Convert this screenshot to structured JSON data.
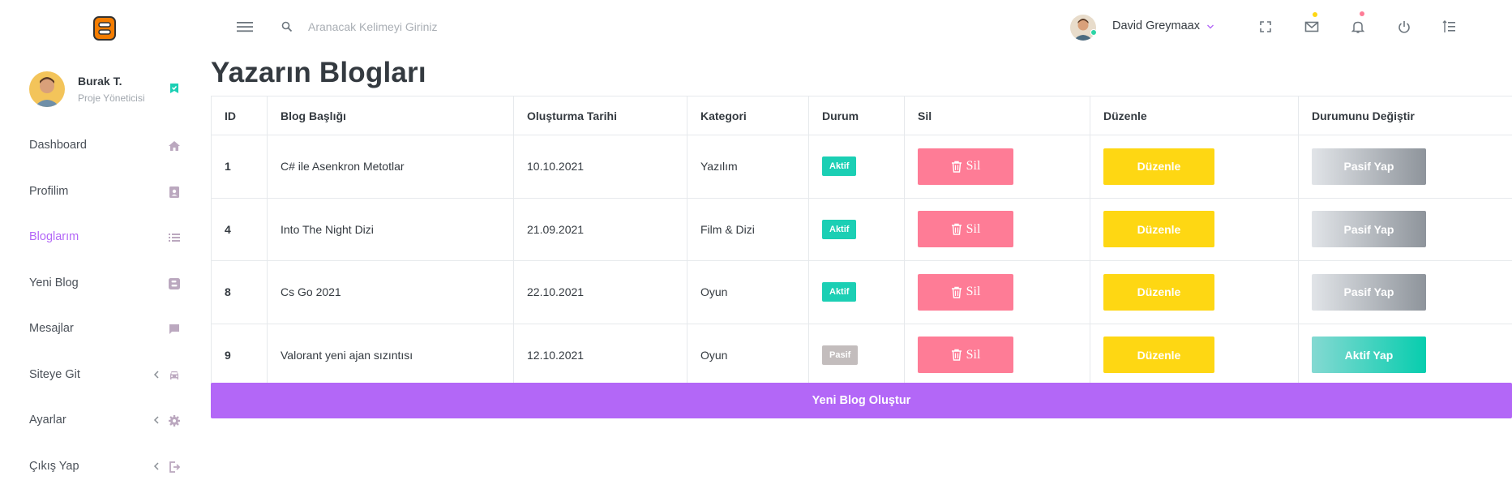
{
  "sidebar": {
    "logo_icon": "blogger-logo-icon",
    "profile": {
      "name": "Burak T.",
      "role": "Proje Yöneticisi"
    },
    "items": [
      {
        "label": "Dashboard",
        "icon": "home-icon"
      },
      {
        "label": "Profilim",
        "icon": "contact-card-icon"
      },
      {
        "label": "Bloglarım",
        "icon": "list-icon",
        "active": true
      },
      {
        "label": "Yeni Blog",
        "icon": "blogger-icon"
      },
      {
        "label": "Mesajlar",
        "icon": "message-icon"
      },
      {
        "label": "Siteye Git",
        "icon": "car-icon",
        "has_submenu": true
      },
      {
        "label": "Ayarlar",
        "icon": "gear-icon",
        "has_submenu": true
      },
      {
        "label": "Çıkış Yap",
        "icon": "logout-icon",
        "has_submenu": true
      }
    ]
  },
  "topbar": {
    "search_placeholder": "Aranacak Kelimeyi Giriniz",
    "user_name": "David Greymaax",
    "icons": [
      "fullscreen-icon",
      "mail-icon",
      "bell-icon",
      "power-icon",
      "format-list-icon"
    ]
  },
  "page": {
    "title": "Yazarın Blogları"
  },
  "table": {
    "headers": [
      "ID",
      "Blog Başlığı",
      "Oluşturma Tarihi",
      "Kategori",
      "Durum",
      "Sil",
      "Düzenle",
      "Durumunu Değiştir"
    ],
    "rows": [
      {
        "id": "1",
        "title": "C# ile Asenkron Metotlar",
        "date": "10.10.2021",
        "category": "Yazılım",
        "status": "Aktif",
        "delete": "Sil",
        "edit": "Düzenle",
        "toggle": "Pasif Yap"
      },
      {
        "id": "4",
        "title": "Into The Night Dizi",
        "date": "21.09.2021",
        "category": "Film & Dizi",
        "status": "Aktif",
        "delete": "Sil",
        "edit": "Düzenle",
        "toggle": "Pasif Yap"
      },
      {
        "id": "8",
        "title": "Cs Go 2021",
        "date": "22.10.2021",
        "category": "Oyun",
        "status": "Aktif",
        "delete": "Sil",
        "edit": "Düzenle",
        "toggle": "Pasif Yap"
      },
      {
        "id": "9",
        "title": "Valorant yeni ajan sızıntısı",
        "date": "12.10.2021",
        "category": "Oyun",
        "status": "Pasif",
        "delete": "Sil",
        "edit": "Düzenle",
        "toggle": "Aktif Yap"
      }
    ]
  },
  "create_button": "Yeni Blog Oluştur",
  "colors": {
    "accent": "#b367f7",
    "active_badge": "#1bcfb4",
    "passive_badge": "#c3bdbd",
    "delete": "#fe7c96",
    "edit": "#fed713",
    "menu_icon": "#bba8bff5"
  }
}
